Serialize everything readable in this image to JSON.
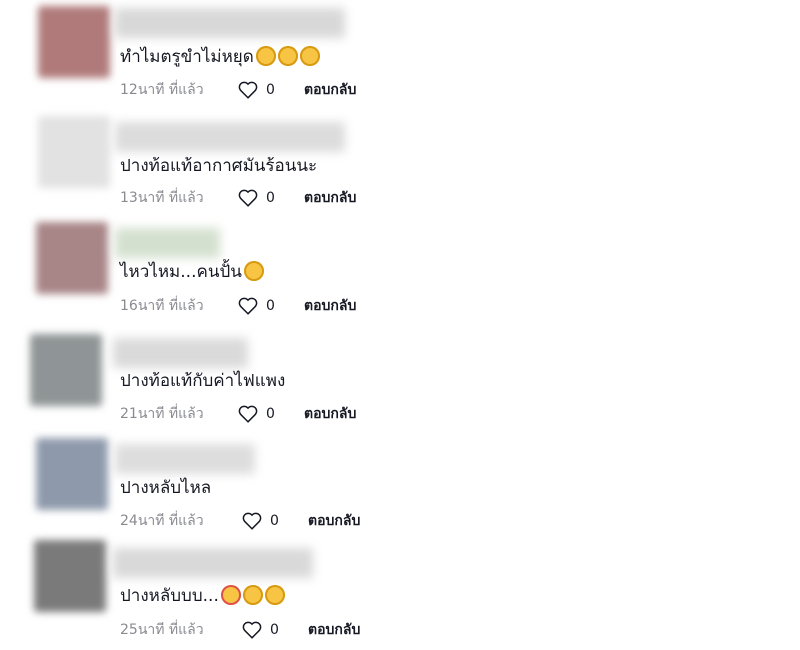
{
  "comments": [
    {
      "text": "ทำไมตรูขำไม่หยุด",
      "time": "12นาที ที่แล้ว",
      "likes": "0",
      "reply": "ตอบกลับ",
      "emojis": [
        "grinning-tears-emoji",
        "grinning-tears-emoji",
        "grinning-tears-emoji"
      ]
    },
    {
      "text": "ปางท้อแท้อากาศมันร้อนนะ",
      "time": "13นาที ที่แล้ว",
      "likes": "0",
      "reply": "ตอบกลับ",
      "emojis": []
    },
    {
      "text": "ไหวไหม...คนปั้น",
      "time": "16นาที ที่แล้ว",
      "likes": "0",
      "reply": "ตอบกลับ",
      "emojis": [
        "grin-sweat-emoji"
      ]
    },
    {
      "text": "ปางท้อแท้กับค่าไฟแพง",
      "time": "21นาที ที่แล้ว",
      "likes": "0",
      "reply": "ตอบกลับ",
      "emojis": []
    },
    {
      "text": "ปางหลับไหล",
      "time": "24นาที ที่แล้ว",
      "likes": "0",
      "reply": "ตอบกลับ",
      "emojis": []
    },
    {
      "text": "ปางหลับบบ...",
      "time": "25นาที ที่แล้ว",
      "likes": "0",
      "reply": "ตอบกลับ",
      "emojis": [
        "hearts-face-emoji",
        "flushed-face-emoji",
        "grin-sweat-emoji"
      ]
    }
  ],
  "colors": {
    "text": "#161823",
    "muted": "#8a8b91",
    "emoji_yellow": "#f7c543",
    "emoji_outline": "#d79a12"
  }
}
